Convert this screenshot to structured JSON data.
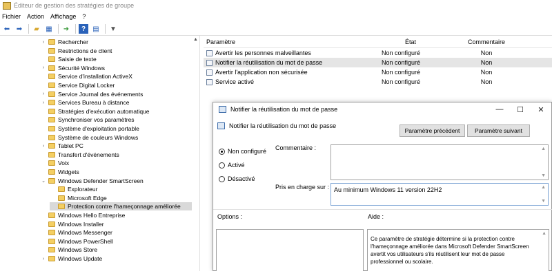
{
  "window": {
    "title": "Éditeur de gestion des stratégies de groupe"
  },
  "menu": [
    "Fichier",
    "Action",
    "Affichage",
    "?"
  ],
  "toolbar_icons": [
    "back-arrow-icon",
    "forward-arrow-icon",
    "folder-up-icon",
    "show-hide-tree-icon",
    "export-list-icon",
    "help-icon",
    "properties-icon",
    "filter-icon"
  ],
  "tree": {
    "items": [
      {
        "label": "Rechercher",
        "chev": "›"
      },
      {
        "label": "Restrictions de client",
        "chev": ""
      },
      {
        "label": "Saisie de texte",
        "chev": ""
      },
      {
        "label": "Sécurité Windows",
        "chev": "›"
      },
      {
        "label": "Service d'installation ActiveX",
        "chev": ""
      },
      {
        "label": "Service Digital Locker",
        "chev": ""
      },
      {
        "label": "Service Journal des événements",
        "chev": "›"
      },
      {
        "label": "Services Bureau à distance",
        "chev": "›"
      },
      {
        "label": "Stratégies d'exécution automatique",
        "chev": ""
      },
      {
        "label": "Synchroniser vos paramètres",
        "chev": ""
      },
      {
        "label": "Système d'exploitation portable",
        "chev": ""
      },
      {
        "label": "Système de couleurs Windows",
        "chev": ""
      },
      {
        "label": "Tablet PC",
        "chev": "›"
      },
      {
        "label": "Transfert d'événements",
        "chev": ""
      },
      {
        "label": "Voix",
        "chev": ""
      },
      {
        "label": "Widgets",
        "chev": ""
      },
      {
        "label": "Windows Defender SmartScreen",
        "chev": "⌄"
      },
      {
        "label": "Explorateur",
        "chev": "",
        "child": true
      },
      {
        "label": "Microsoft Edge",
        "chev": "",
        "child": true
      },
      {
        "label": "Protection contre l'hameçonnage améliorée",
        "chev": "",
        "child": true,
        "selected": true
      },
      {
        "label": "Windows Hello Entreprise",
        "chev": ""
      },
      {
        "label": "Windows Installer",
        "chev": ""
      },
      {
        "label": "Windows Messenger",
        "chev": ""
      },
      {
        "label": "Windows PowerShell",
        "chev": ""
      },
      {
        "label": "Windows Store",
        "chev": ""
      },
      {
        "label": "Windows Update",
        "chev": "›"
      }
    ]
  },
  "list": {
    "headers": {
      "param": "Paramètre",
      "etat": "État",
      "comm": "Commentaire"
    },
    "rows": [
      {
        "param": "Avertir les personnes malveillantes",
        "etat": "Non configuré",
        "comm": "Non"
      },
      {
        "param": "Notifier la réutilisation du mot de passe",
        "etat": "Non configuré",
        "comm": "Non",
        "hl": true
      },
      {
        "param": "Avertir l'application non sécurisée",
        "etat": "Non configuré",
        "comm": "Non"
      },
      {
        "param": "Service activé",
        "etat": "Non configuré",
        "comm": "Non"
      }
    ]
  },
  "dialog": {
    "title": "Notifier la réutilisation du mot de passe",
    "subtitle": "Notifier la réutilisation du mot de passe",
    "prev_button": "Paramètre précédent",
    "next_button": "Paramètre suivant",
    "radio_not_configured": "Non configuré",
    "radio_enabled": "Activé",
    "radio_disabled": "Désactivé",
    "comment_label": "Commentaire :",
    "supported_label": "Pris en charge sur :",
    "supported_value": "Au minimum Windows 11 version 22H2",
    "options_label": "Options :",
    "help_label": "Aide :",
    "help_text": "Ce paramètre de stratégie détermine si la protection contre l'hameçonnage améliorée dans Microsoft Defender SmartScreen avertit vos utilisateurs s'ils réutilisent leur mot de passe professionnel ou scolaire.",
    "window_controls": {
      "minimize": "—",
      "maximize": "☐",
      "close": "✕"
    }
  }
}
